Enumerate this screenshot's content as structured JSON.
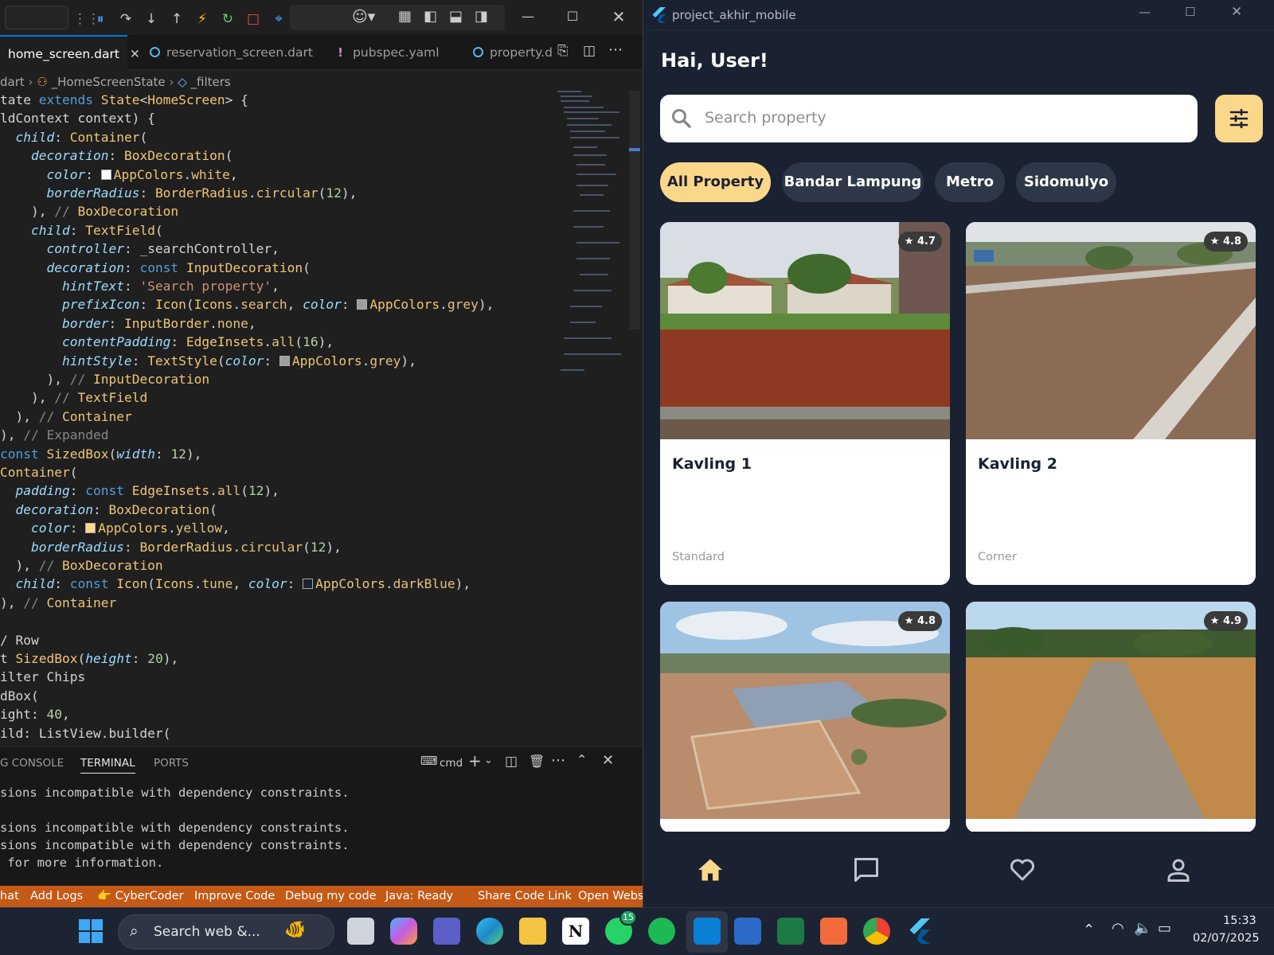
{
  "vscode": {
    "tabs": [
      {
        "label": "home_screen.dart",
        "active": true,
        "close": "✕"
      },
      {
        "label": "reservation_screen.dart"
      },
      {
        "label": "pubspec.yaml"
      },
      {
        "label": "property.d"
      }
    ],
    "breadcrumb": {
      "file": "dart",
      "class": "_HomeScreenState",
      "member": "_filters"
    },
    "code_lines": [
      "tate extends State<HomeScreen> {",
      "ldContext context) {",
      "  child: Container(",
      "    decoration: BoxDecoration(",
      "      color: AppColors.white,",
      "      borderRadius: BorderRadius.circular(12),",
      "    ), // BoxDecoration",
      "    child: TextField(",
      "      controller: _searchController,",
      "      decoration: const InputDecoration(",
      "        hintText: 'Search property',",
      "        prefixIcon: Icon(Icons.search, color: AppColors.grey),",
      "        border: InputBorder.none,",
      "        contentPadding: EdgeInsets.all(16),",
      "        hintStyle: TextStyle(color: AppColors.grey),",
      "      ), // InputDecoration",
      "    ), // TextField",
      "  ), // Container",
      "), // Expanded",
      "const SizedBox(width: 12),",
      "Container(",
      "  padding: const EdgeInsets.all(12),",
      "  decoration: BoxDecoration(",
      "    color: AppColors.yellow,",
      "    borderRadius: BorderRadius.circular(12),",
      "  ), // BoxDecoration",
      "  child: const Icon(Icons.tune, color: AppColors.darkBlue),",
      "), // Container",
      "",
      "/ Row",
      "t SizedBox(height: 20),",
      "ilter Chips",
      "dBox(",
      "ight: 40,",
      "ild: ListView.builder("
    ],
    "panel": {
      "tabs": [
        "G CONSOLE",
        "TERMINAL",
        "PORTS"
      ],
      "shell": "cmd",
      "terminal_lines": [
        "sions incompatible with dependency constraints.",
        "",
        "sions incompatible with dependency constraints.",
        "sions incompatible with dependency constraints.",
        " for more information."
      ]
    },
    "statusbar": [
      "hat",
      "Add Logs",
      "👉 CyberCoder",
      "Improve Code",
      "Debug my code",
      "Java: Ready",
      "Share Code Link",
      "Open Websi"
    ]
  },
  "app": {
    "window_title": "project_akhir_mobile",
    "greeting": "Hai, User!",
    "search_placeholder": "Search property",
    "chips": [
      "All Property",
      "Bandar Lampung",
      "Metro",
      "Sidomulyo"
    ],
    "cards": [
      {
        "name": "Kavling 1",
        "type": "Standard",
        "rating": "4.7"
      },
      {
        "name": "Kavling 2",
        "type": "Corner",
        "rating": "4.8"
      },
      {
        "name": "",
        "type": "",
        "rating": "4.8"
      },
      {
        "name": "",
        "type": "",
        "rating": "4.9"
      }
    ],
    "nav": [
      "home-icon",
      "chat-icon",
      "favorite-icon",
      "profile-icon"
    ]
  },
  "taskbar": {
    "search_placeholder": "Search web &...",
    "whatsapp_badge": "15",
    "time": "15:33",
    "date": "02/07/2025"
  },
  "colors": {
    "accent_yellow": "#fbd78a",
    "app_bg": "#1a2130",
    "status_orange": "#c45a16"
  }
}
